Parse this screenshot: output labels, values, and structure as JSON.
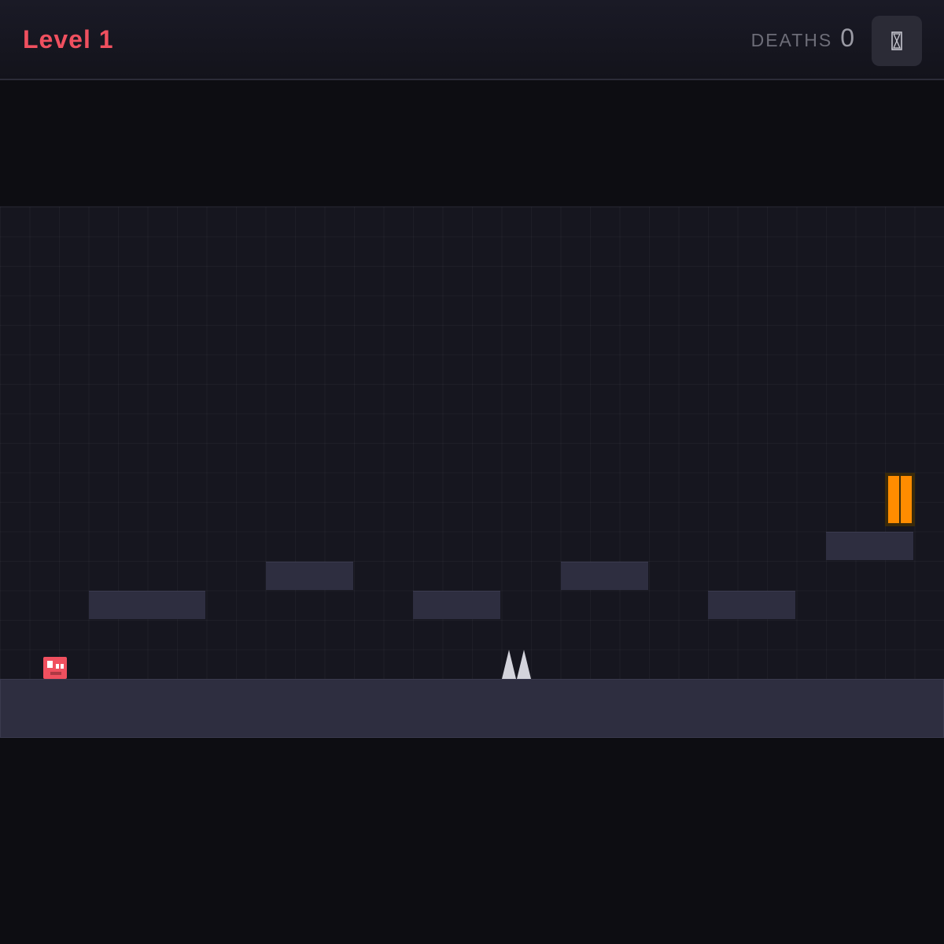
{
  "header": {
    "level_title": "Level 1",
    "deaths_label": "DEATHS",
    "deaths_count": "0",
    "menu_icon": "hourglass-icon",
    "menu_glyph": "⧖"
  },
  "game": {
    "colors": {
      "accent": "#f0505f",
      "player": "#f0505f",
      "spike": "#d4d4dc",
      "door": "#ff8c00",
      "door_frame": "#3a2a0a",
      "platform": "#2e2e40",
      "background": "#16161f"
    },
    "player": {
      "name": "player"
    },
    "exit": {
      "name": "exit-door"
    }
  }
}
